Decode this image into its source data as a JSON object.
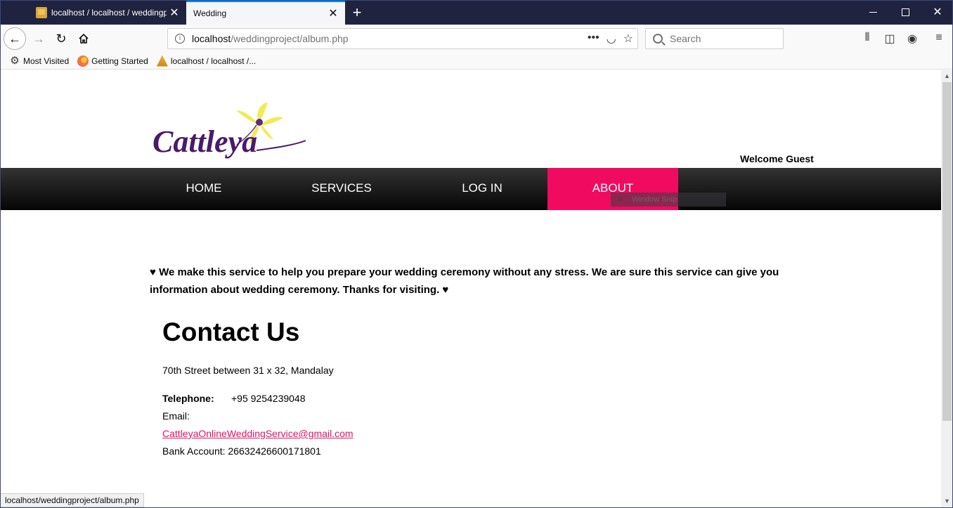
{
  "browser": {
    "tabs": [
      {
        "title": "localhost / localhost / weddingpro",
        "active": false
      },
      {
        "title": "Wedding",
        "active": true
      }
    ],
    "new_tab_label": "+",
    "url_host": "localhost",
    "url_path": "/weddingproject/album.php",
    "search_placeholder": "Search",
    "bookmarks": [
      {
        "label": "Most Visited",
        "icon": "gear-icon"
      },
      {
        "label": "Getting Started",
        "icon": "firefox-icon"
      },
      {
        "label": "localhost / localhost /...",
        "icon": "phpmyadmin-icon"
      }
    ],
    "status_url": "localhost/weddingproject/album.php",
    "overlay_label": "Window Snip"
  },
  "site": {
    "logo_text": "Cattleya",
    "welcome": "Welcome Guest",
    "menu": [
      "HOME",
      "SERVICES",
      "LOG IN",
      "ABOUT"
    ],
    "active_menu": "ABOUT",
    "accent_color": "#f00b60",
    "intro": "♥ We make this service to help you prepare your wedding ceremony without any stress. We are sure this service can give you information about wedding ceremony. Thanks for visiting. ♥",
    "contact": {
      "heading": "Contact Us",
      "address": "70th Street between 31 x 32, Mandalay",
      "telephone_label": "Telephone:",
      "telephone_value": "+95 9254239048",
      "email_label": "Email:",
      "email_value": "CattleyaOnlineWeddingService@gmail.com",
      "bank_account": "Bank Account: 26632426600171801"
    }
  }
}
